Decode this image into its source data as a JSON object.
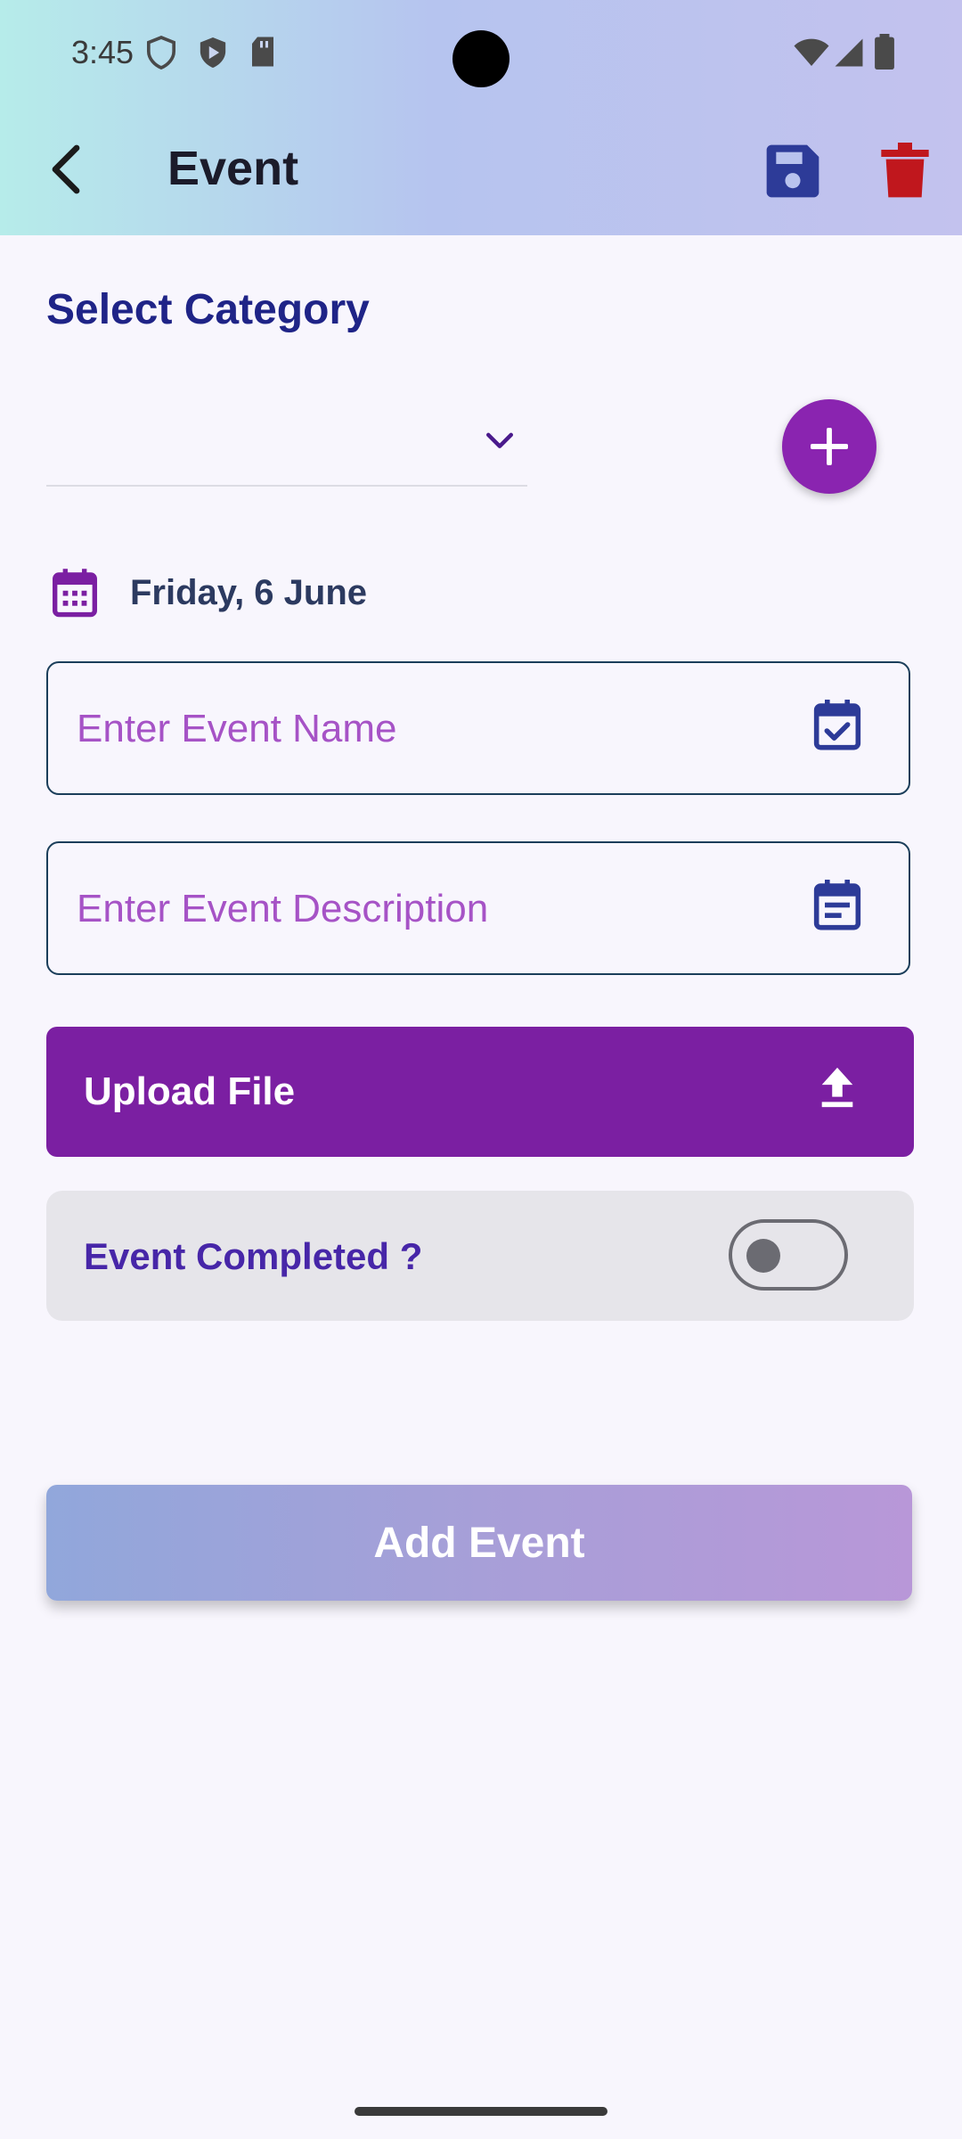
{
  "status_bar": {
    "time": "3:45"
  },
  "app_bar": {
    "title": "Event",
    "icons": {
      "back": "arrow-back-icon",
      "save": "save-icon",
      "delete": "trash-icon"
    },
    "colors": {
      "save": "#2d3b98",
      "delete": "#c0171d"
    }
  },
  "category": {
    "title": "Select Category",
    "selected": "",
    "add_icon": "plus-icon"
  },
  "date": {
    "text": "Friday, 6 June",
    "icon": "calendar-icon"
  },
  "event_name": {
    "placeholder": "Enter Event Name",
    "value": "",
    "icon": "event-available-icon"
  },
  "event_description": {
    "placeholder": "Enter Event Description",
    "value": "",
    "icon": "event-note-icon"
  },
  "upload": {
    "label": "Upload File",
    "icon": "upload-icon"
  },
  "completed": {
    "label": "Event Completed ?",
    "checked": false
  },
  "submit": {
    "label": "Add Event"
  },
  "colors": {
    "primary": "#7b1fa2",
    "title": "#1f2487",
    "accent_text": "#4726a8"
  }
}
